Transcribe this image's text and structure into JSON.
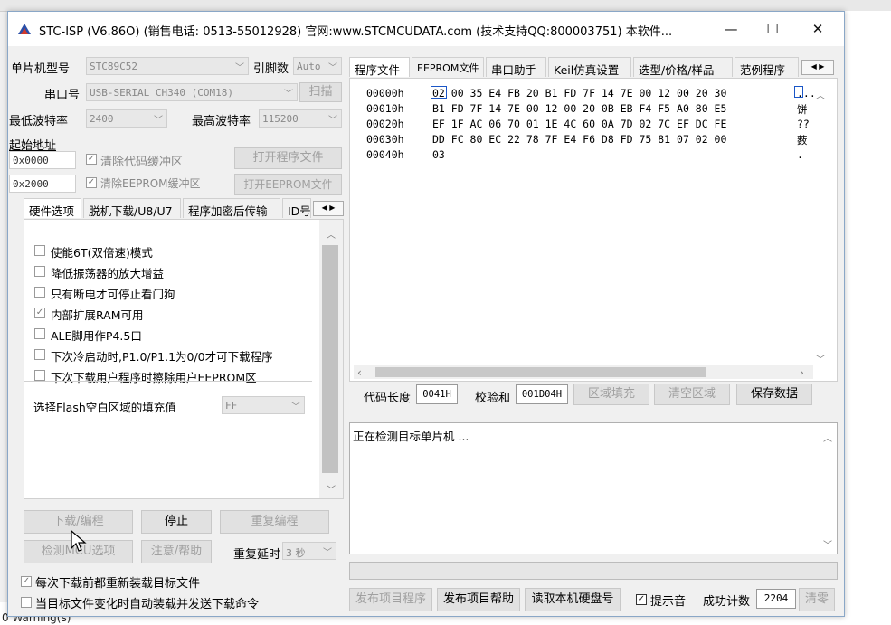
{
  "window": {
    "title": "STC-ISP (V6.86O) (销售电话: 0513-55012928) 官网:www.STCMCUDATA.com  (技术支持QQ:800003751) 本软件...",
    "minimize": "—",
    "maximize": "☐",
    "close": "✕"
  },
  "left": {
    "mcu_model_label": "单片机型号",
    "mcu_model_value": "STC89C52",
    "pin_count_label": "引脚数",
    "pin_count_value": "Auto",
    "port_label": "串口号",
    "port_value": "USB-SERIAL CH340 (COM18)",
    "scan_button": "扫描",
    "min_baud_label": "最低波特率",
    "min_baud_value": "2400",
    "max_baud_label": "最高波特率",
    "max_baud_value": "115200",
    "start_addr_label": "起始地址",
    "addr1_value": "0x0000",
    "clear_code_label": "清除代码缓冲区",
    "open_program_button": "打开程序文件",
    "addr2_value": "0x2000",
    "clear_eeprom_label": "清除EEPROM缓冲区",
    "open_eeprom_button": "打开EEPROM文件",
    "tabs": [
      "硬件选项",
      "脱机下载/U8/U7",
      "程序加密后传输",
      "ID号"
    ],
    "options": [
      {
        "label": "使能6T(双倍速)模式",
        "checked": false
      },
      {
        "label": "降低振荡器的放大增益",
        "checked": false
      },
      {
        "label": "只有断电才可停止看门狗",
        "checked": false
      },
      {
        "label": "内部扩展RAM可用",
        "checked": true
      },
      {
        "label": "ALE脚用作P4.5口",
        "checked": false
      },
      {
        "label": "下次冷启动时,P1.0/P1.1为0/0才可下载程序",
        "checked": false
      },
      {
        "label": "下次下载用户程序时擦除用户EEPROM区",
        "checked": false
      }
    ],
    "flash_fill_label": "选择Flash空白区域的填充值",
    "flash_fill_value": "FF",
    "download_button": "下载/编程",
    "stop_button": "停止",
    "reprogram_button": "重复编程",
    "check_mcu_button": "检测MCU选项",
    "help_button": "注意/帮助",
    "repeat_delay_label": "重复延时",
    "repeat_delay_value": "3 秒",
    "reload_label": "每次下载前都重新装载目标文件",
    "reload_checked": true,
    "auto_send_label": "当目标文件变化时自动装载并发送下载命令",
    "auto_send_checked": false
  },
  "right": {
    "tabs": [
      "程序文件",
      "EEPROM文件",
      "串口助手",
      "Keil仿真设置",
      "选型/价格/样品",
      "范例程序"
    ],
    "hex_rows": [
      {
        "addr": "00000h",
        "bytes": "02 00 35 E4 FB 20 B1 FD 7F 14 7E 00 12 00 20 30",
        "ascii": "..."
      },
      {
        "addr": "00010h",
        "bytes": "B1 FD 7F 14 7E 00 12 00 20 0B EB F4 F5 A0 80 E5",
        "ascii": "饼"
      },
      {
        "addr": "00020h",
        "bytes": "EF 1F AC 06 70 01 1E 4C 60 0A 7D 02 7C EF DC FE",
        "ascii": "??"
      },
      {
        "addr": "00030h",
        "bytes": "DD FC 80 EC 22 78 7F E4 F6 D8 FD 75 81 07 02 00",
        "ascii": "薮"
      },
      {
        "addr": "00040h",
        "bytes": "03",
        "ascii": "."
      }
    ],
    "code_length_label": "代码长度",
    "code_length_value": "0041H",
    "checksum_label": "校验和",
    "checksum_value": "001D04H",
    "region_fill_button": "区域填充",
    "clear_region_button": "清空区域",
    "save_data_button": "保存数据",
    "status_text": "正在检测目标单片机 ...",
    "publish_program_button": "发布项目程序",
    "publish_help_button": "发布项目帮助",
    "read_disk_button": "读取本机硬盘号",
    "sound_label": "提示音",
    "sound_checked": true,
    "success_count_label": "成功计数",
    "success_count_value": "2204",
    "clear_count_button": "清零"
  },
  "background": {
    "bottom_text": "0 Warning(s)"
  }
}
